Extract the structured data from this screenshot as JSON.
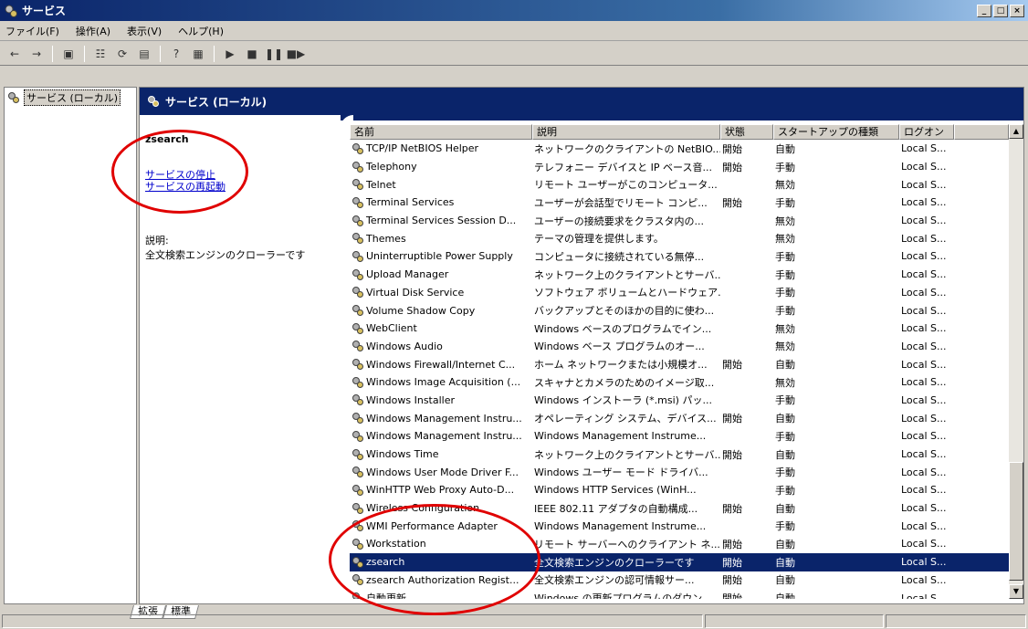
{
  "window": {
    "title": "サービス",
    "controls": [
      "_",
      "□",
      "×"
    ]
  },
  "menu": [
    "ファイル(F)",
    "操作(A)",
    "表示(V)",
    "ヘルプ(H)"
  ],
  "toolbar": {
    "buttons": [
      "back-icon",
      "forward-icon",
      "console-tree-icon",
      "properties-icon",
      "refresh-icon",
      "export-icon",
      "help-icon",
      "view-icon",
      "start-icon",
      "stop-icon",
      "pause-icon",
      "restart-icon"
    ]
  },
  "tree": {
    "root_label": "サービス (ローカル)"
  },
  "pane": {
    "header": "サービス (ローカル)",
    "selected_name": "zsearch",
    "link_stop": "サービスの停止",
    "link_restart": "サービスの再起動",
    "desc_label": "説明:",
    "desc_text": "全文検索エンジンのクローラーです"
  },
  "columns": [
    "名前",
    "説明",
    "状態",
    "スタートアップの種類",
    "ログオン"
  ],
  "rows": [
    {
      "name": "TCP/IP NetBIOS Helper",
      "desc": "ネットワークのクライアントの NetBIO...",
      "status": "開始",
      "startup": "自動",
      "logon": "Local S..."
    },
    {
      "name": "Telephony",
      "desc": "テレフォニー デバイスと IP ベース音...",
      "status": "開始",
      "startup": "手動",
      "logon": "Local S..."
    },
    {
      "name": "Telnet",
      "desc": "リモート ユーザーがこのコンピュータ...",
      "status": "",
      "startup": "無効",
      "logon": "Local S..."
    },
    {
      "name": "Terminal Services",
      "desc": "ユーザーが会話型でリモート コンピ...",
      "status": "開始",
      "startup": "手動",
      "logon": "Local S..."
    },
    {
      "name": "Terminal Services Session D...",
      "desc": "ユーザーの接続要求をクラスタ内の...",
      "status": "",
      "startup": "無効",
      "logon": "Local S..."
    },
    {
      "name": "Themes",
      "desc": "テーマの管理を提供します。",
      "status": "",
      "startup": "無効",
      "logon": "Local S..."
    },
    {
      "name": "Uninterruptible Power Supply",
      "desc": "コンピュータに接続されている無停...",
      "status": "",
      "startup": "手動",
      "logon": "Local S..."
    },
    {
      "name": "Upload Manager",
      "desc": "ネットワーク上のクライアントとサーバ...",
      "status": "",
      "startup": "手動",
      "logon": "Local S..."
    },
    {
      "name": "Virtual Disk Service",
      "desc": "ソフトウェア ボリュームとハードウェア...",
      "status": "",
      "startup": "手動",
      "logon": "Local S..."
    },
    {
      "name": "Volume Shadow Copy",
      "desc": "バックアップとそのほかの目的に使わ...",
      "status": "",
      "startup": "手動",
      "logon": "Local S..."
    },
    {
      "name": "WebClient",
      "desc": "Windows ベースのプログラムでイン...",
      "status": "",
      "startup": "無効",
      "logon": "Local S..."
    },
    {
      "name": "Windows Audio",
      "desc": "Windows ベース プログラムのオー...",
      "status": "",
      "startup": "無効",
      "logon": "Local S..."
    },
    {
      "name": "Windows Firewall/Internet C...",
      "desc": "ホーム ネットワークまたは小規模オ...",
      "status": "開始",
      "startup": "自動",
      "logon": "Local S..."
    },
    {
      "name": "Windows Image Acquisition (...",
      "desc": "スキャナとカメラのためのイメージ取...",
      "status": "",
      "startup": "無効",
      "logon": "Local S..."
    },
    {
      "name": "Windows Installer",
      "desc": "Windows インストーラ (*.msi) パッ...",
      "status": "",
      "startup": "手動",
      "logon": "Local S..."
    },
    {
      "name": "Windows Management Instru...",
      "desc": "オペレーティング システム、デバイス...",
      "status": "開始",
      "startup": "自動",
      "logon": "Local S..."
    },
    {
      "name": "Windows Management Instru...",
      "desc": "Windows Management Instrume...",
      "status": "",
      "startup": "手動",
      "logon": "Local S..."
    },
    {
      "name": "Windows Time",
      "desc": "ネットワーク上のクライアントとサーバ...",
      "status": "開始",
      "startup": "自動",
      "logon": "Local S..."
    },
    {
      "name": "Windows User Mode Driver F...",
      "desc": "Windows ユーザー モード ドライバ...",
      "status": "",
      "startup": "手動",
      "logon": "Local S..."
    },
    {
      "name": "WinHTTP Web Proxy Auto-D...",
      "desc": "Windows HTTP Services (WinH...",
      "status": "",
      "startup": "手動",
      "logon": "Local S..."
    },
    {
      "name": "Wireless Configuration",
      "desc": "IEEE 802.11 アダプタの自動構成...",
      "status": "開始",
      "startup": "自動",
      "logon": "Local S..."
    },
    {
      "name": "WMI Performance Adapter",
      "desc": "Windows Management Instrume...",
      "status": "",
      "startup": "手動",
      "logon": "Local S..."
    },
    {
      "name": "Workstation",
      "desc": "リモート サーバーへのクライアント ネ...",
      "status": "開始",
      "startup": "自動",
      "logon": "Local S..."
    },
    {
      "name": "zsearch",
      "desc": "全文検索エンジンのクローラーです",
      "status": "開始",
      "startup": "自動",
      "logon": "Local S...",
      "selected": true
    },
    {
      "name": "zsearch Authorization Regist...",
      "desc": "全文検索エンジンの認可情報サー...",
      "status": "開始",
      "startup": "自動",
      "logon": "Local S..."
    },
    {
      "name": "自動更新",
      "desc": "Windows の更新プログラムのダウン...",
      "status": "開始",
      "startup": "自動",
      "logon": "Local S..."
    }
  ],
  "tabs": [
    "拡張",
    "標準"
  ],
  "colors": {
    "titlebar": "#0a246a",
    "selection": "#0a246a",
    "annotation": "#e00000",
    "link": "#0000cc"
  }
}
